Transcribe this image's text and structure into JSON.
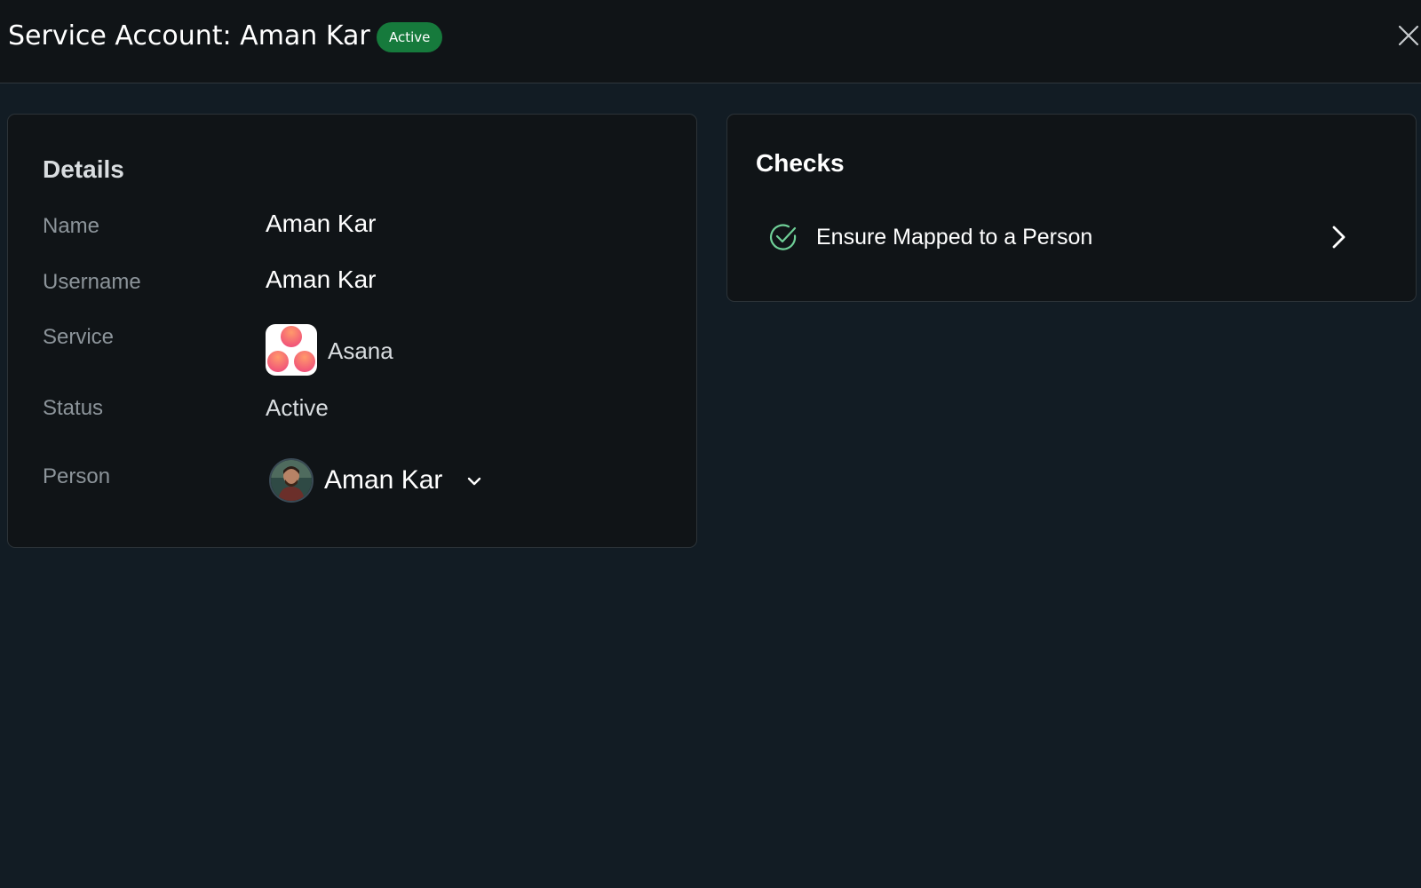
{
  "header": {
    "title": "Service Account: Aman Kar",
    "status_badge": "Active",
    "close_icon": "close-icon"
  },
  "details": {
    "title": "Details",
    "rows": {
      "name": {
        "label": "Name",
        "value": "Aman Kar"
      },
      "username": {
        "label": "Username",
        "value": "Aman Kar"
      },
      "service": {
        "label": "Service",
        "value": "Asana",
        "icon": "asana-logo-icon"
      },
      "status": {
        "label": "Status",
        "value": "Active"
      },
      "person": {
        "label": "Person",
        "value": "Aman Kar",
        "icon": "chevron-down-icon"
      }
    }
  },
  "checks": {
    "title": "Checks",
    "items": [
      {
        "label": "Ensure Mapped to a Person",
        "icon": "check-circle-icon",
        "action_icon": "chevron-right-icon"
      }
    ]
  },
  "colors": {
    "background": "#121c24",
    "panel": "#101417",
    "badge_green": "#167a3c",
    "check_green": "#6fcf97",
    "asana_coral": "#f06a6a",
    "muted_text": "#8c949a"
  }
}
